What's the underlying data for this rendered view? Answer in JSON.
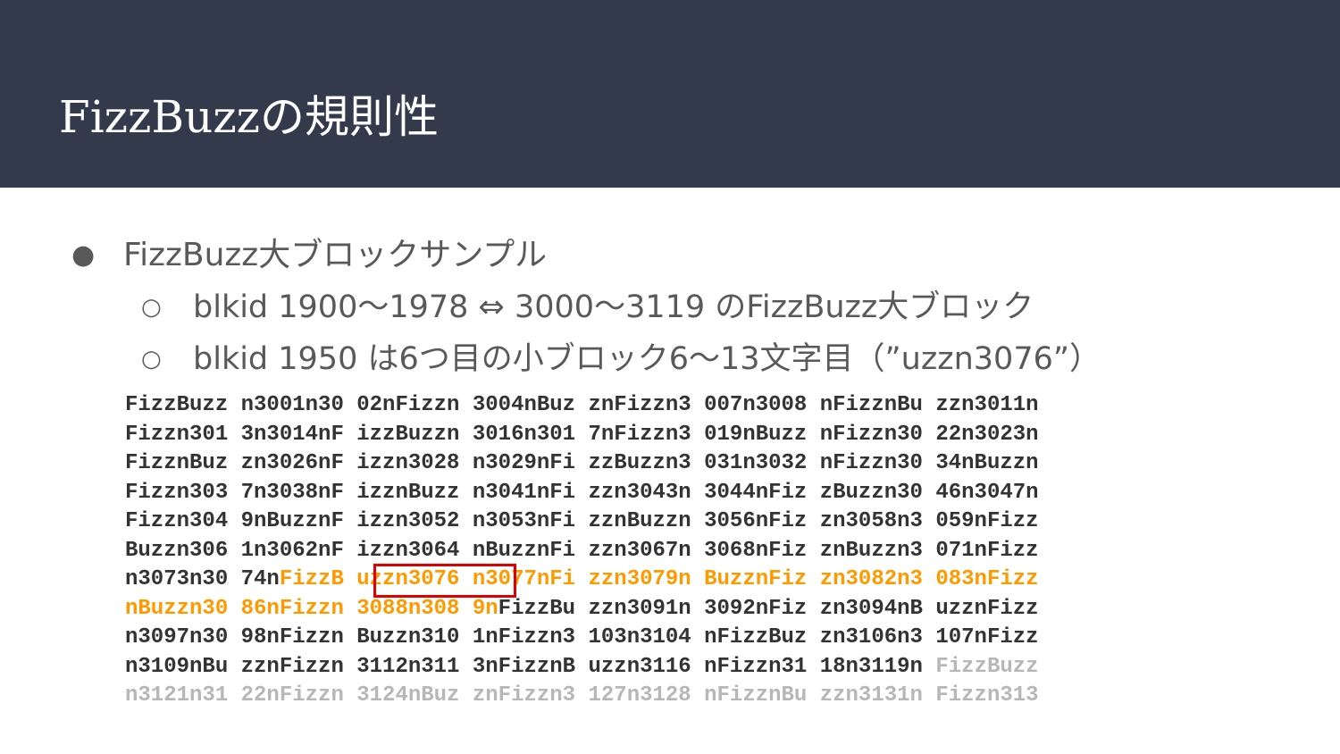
{
  "title": "FizzBuzzの規則性",
  "bullets": [
    {
      "marker": "●",
      "text": "FizzBuzz大ブロックサンプル"
    },
    {
      "marker": "○",
      "text": "blkid 1900〜1978 ⇔ 3000〜3119 のFizzBuzz大ブロック"
    },
    {
      "marker": "○",
      "text": "blkid 1950 は6つ目の小ブロック6〜13文字目（”uzzn3076”）"
    }
  ],
  "colors": {
    "header": "#323a4b",
    "normal_text": "#333333",
    "highlight": "#ff9900",
    "dimmed": "#b7b7b7",
    "box": "#e00000"
  },
  "stream": [
    [
      {
        "t": "FizzBuzz n3001n30 02nFizzn 3004nBuz znFizzn3 007n3008 nFizznBu zzn3011n",
        "c": "n"
      }
    ],
    [
      {
        "t": "Fizzn301 3n3014nF izzBuzzn 3016n301 7nFizzn3 019nBuzz nFizzn30 22n3023n",
        "c": "n"
      }
    ],
    [
      {
        "t": "FizznBuz zn3026nF izzn3028 n3029nFi zzBuzzn3 031n3032 nFizzn30 34nBuzzn",
        "c": "n"
      }
    ],
    [
      {
        "t": "Fizzn303 7n3038nF izznBuzz n3041nFi zzn3043n 3044nFiz zBuzzn30 46n3047n",
        "c": "n"
      }
    ],
    [
      {
        "t": "Fizzn304 9nBuzznF izzn3052 n3053nFi zznBuzzn 3056nFiz zn3058n3 059nFizz",
        "c": "n"
      }
    ],
    [
      {
        "t": "Buzzn306 1n3062nF izzn3064 nBuzznFi zzn3067n 3068nFiz znBuzzn3 071nFizz",
        "c": "n"
      }
    ],
    [
      {
        "t": "n3073n30 74n",
        "c": "n"
      },
      {
        "t": "FizzB uzzn3076 n3077nFi zzn3079n BuzznFiz zn3082n3 083nFizz",
        "c": "h"
      }
    ],
    [
      {
        "t": "nBuzzn30 86nFizzn 3088n308 9n",
        "c": "h"
      },
      {
        "t": "FizzBu zzn3091n 3092nFiz zn3094nB uzznFizz",
        "c": "n"
      }
    ],
    [
      {
        "t": "n3097n30 98nFizzn Buzzn310 1nFizzn3 103n3104 nFizzBuz zn3106n3 107nFizz",
        "c": "n"
      }
    ],
    [
      {
        "t": "n3109nBu zznFizzn 3112n311 3nFizznB uzzn3116 nFizzn31 18n3119n ",
        "c": "n"
      },
      {
        "t": "FizzBuzz",
        "c": "d"
      }
    ],
    [
      {
        "t": "n3121n31 22nFizzn 3124nBuz znFizzn3 127n3128 nFizznBu zzn3131n Fizzn313",
        "c": "d"
      }
    ]
  ]
}
